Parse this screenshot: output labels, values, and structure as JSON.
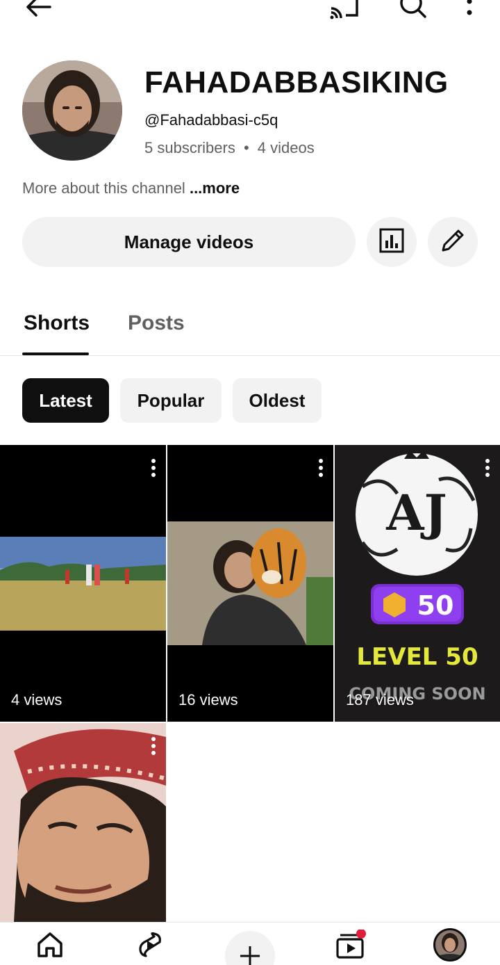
{
  "channel": {
    "name": "FAHADABBASIKING",
    "handle": "@Fahadabbasi-c5q",
    "subscribers": "5 subscribers",
    "separator": "•",
    "videos": "4 videos",
    "about_text": "More about this channel",
    "about_more": "...more"
  },
  "actions": {
    "manage_videos": "Manage videos"
  },
  "tabs": [
    {
      "label": "Shorts",
      "selected": true
    },
    {
      "label": "Posts",
      "selected": false
    }
  ],
  "filters": [
    {
      "label": "Latest",
      "selected": true
    },
    {
      "label": "Popular",
      "selected": false
    },
    {
      "label": "Oldest",
      "selected": false
    }
  ],
  "shorts": [
    {
      "views": "4 views"
    },
    {
      "views": "16 views"
    },
    {
      "views": "187 views",
      "badge_value": "50",
      "overlay_title": "LEVEL 50",
      "overlay_sub": "COMING SOON"
    },
    {
      "views": ""
    }
  ],
  "colors": {
    "accent_dark": "#0f0f0f",
    "muted": "#606060",
    "chip_bg": "#f2f2f2",
    "notification_dot": "#e01e3c",
    "level_yellow": "#e4e83a",
    "badge_purple": "#7b2fd1"
  },
  "icons": [
    "back-arrow-icon",
    "cast-icon",
    "search-icon",
    "more-vert-icon",
    "analytics-icon",
    "pencil-icon",
    "home-icon",
    "shorts-icon",
    "create-icon",
    "subscriptions-icon",
    "profile-avatar-icon"
  ]
}
